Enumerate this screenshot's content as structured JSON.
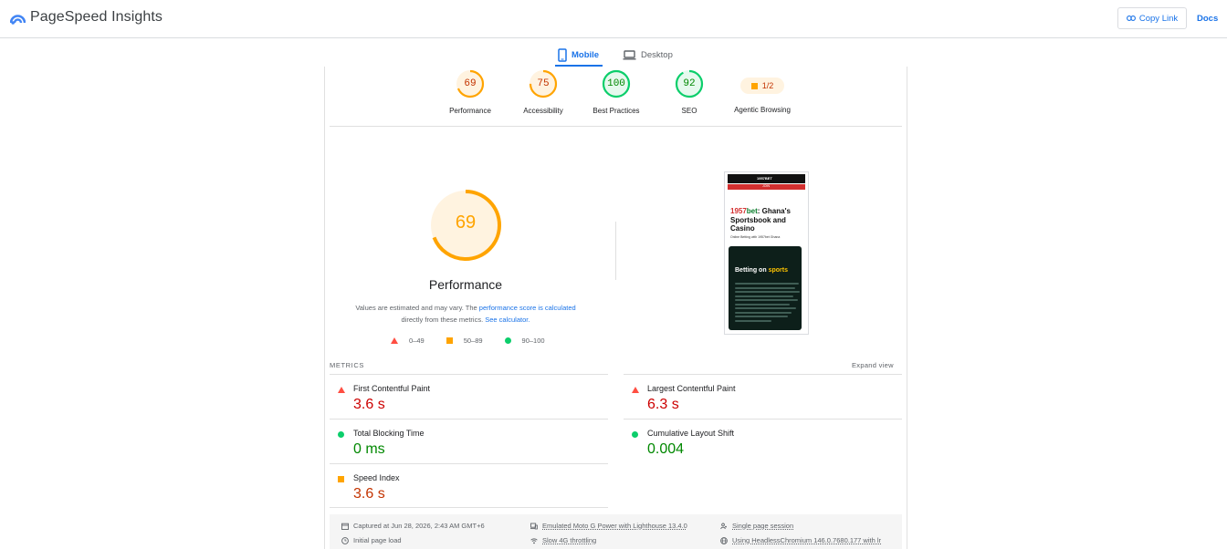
{
  "app": {
    "title": "PageSpeed Insights"
  },
  "header": {
    "copy_link": "Copy Link",
    "docs": "Docs"
  },
  "tabs": {
    "mobile": "Mobile",
    "desktop": "Desktop"
  },
  "colors": {
    "fail": "#ff4e42",
    "average": "#ffa400",
    "pass": "#0cce6b",
    "accent": "#1a73e8"
  },
  "categories": [
    {
      "label": "Performance",
      "score": "69",
      "value": 69,
      "rating": "average"
    },
    {
      "label": "Accessibility",
      "score": "75",
      "value": 75,
      "rating": "average"
    },
    {
      "label": "Best Practices",
      "score": "100",
      "value": 100,
      "rating": "pass"
    },
    {
      "label": "SEO",
      "score": "92",
      "value": 92,
      "rating": "pass"
    },
    {
      "label": "Agentic Browsing",
      "score": "1/2",
      "rating": "average"
    }
  ],
  "summary": {
    "score": "69",
    "value": 69,
    "title": "Performance",
    "note_prefix": "Values are estimated and may vary. The ",
    "note_link1": "performance score is calculated",
    "note_middle": " directly from these metrics. ",
    "note_link2": "See calculator."
  },
  "legend": [
    {
      "range": "0–49",
      "shape": "triangle"
    },
    {
      "range": "50–89",
      "shape": "square"
    },
    {
      "range": "90–100",
      "shape": "circle"
    }
  ],
  "screenshot": {
    "logo": "1957BET",
    "bar_text": "JOIN",
    "headline_red": "1957",
    "headline_green": "bet",
    "headline_rest": ": Ghana's Sportsbook and Casino",
    "subline": "Online Betting with 1957bet Ghana",
    "card_title_prefix": "Betting on ",
    "card_title_highlight": "sports"
  },
  "metrics": {
    "label": "METRICS",
    "expand": "Expand view",
    "items": [
      {
        "name": "First Contentful Paint",
        "value": "3.6 s",
        "rating": "fail"
      },
      {
        "name": "Largest Contentful Paint",
        "value": "6.3 s",
        "rating": "fail"
      },
      {
        "name": "Total Blocking Time",
        "value": "0 ms",
        "rating": "pass"
      },
      {
        "name": "Cumulative Layout Shift",
        "value": "0.004",
        "rating": "pass"
      },
      {
        "name": "Speed Index",
        "value": "3.6 s",
        "rating": "average"
      }
    ]
  },
  "footer": {
    "captured": "Captured at Jun 28, 2026, 2:43 AM GMT+6",
    "load": "Initial page load",
    "device": "Emulated Moto G Power with Lighthouse 13.4.0",
    "throttling": "Slow 4G throttling",
    "session": "Single page session",
    "browser": "Using HeadlessChromium 146.0.7680.177 with lr"
  }
}
